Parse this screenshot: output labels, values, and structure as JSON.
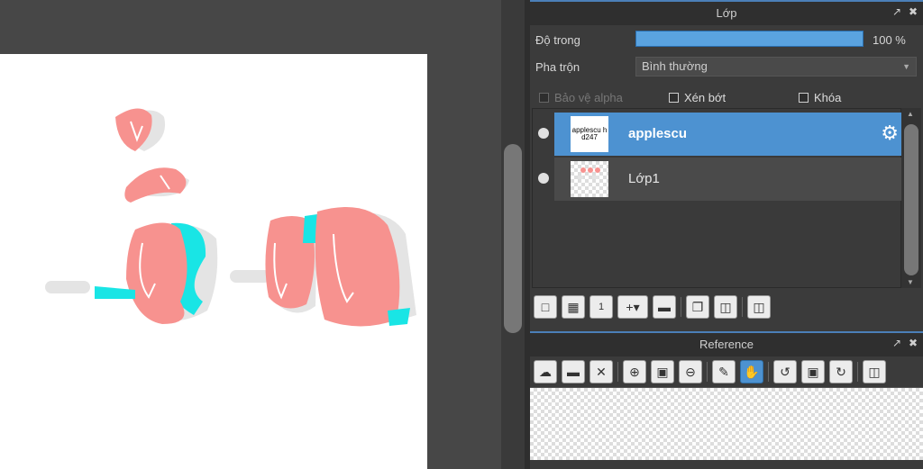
{
  "layer_panel": {
    "title": "Lớp",
    "opacity_label": "Độ trong",
    "opacity_value": "100 %",
    "opacity_fraction": 1.0,
    "blend_label": "Pha trộn",
    "blend_value": "Bình thường",
    "protect_alpha_label": "Bảo vệ alpha",
    "clipping_label": "Xén bớt",
    "lock_label": "Khóa",
    "layers": [
      {
        "name": "applescu",
        "thumb_text": "applescu hd247",
        "selected": true
      },
      {
        "name": "Lớp1",
        "selected": false
      }
    ]
  },
  "reference_panel": {
    "title": "Reference"
  },
  "icons": {
    "popout": "popout-icon",
    "close": "close-icon",
    "gear": "gear-icon"
  },
  "colors": {
    "accent": "#4d92d1",
    "stroke_pink": "#f7928f",
    "stroke_cyan": "#19e5e5"
  }
}
